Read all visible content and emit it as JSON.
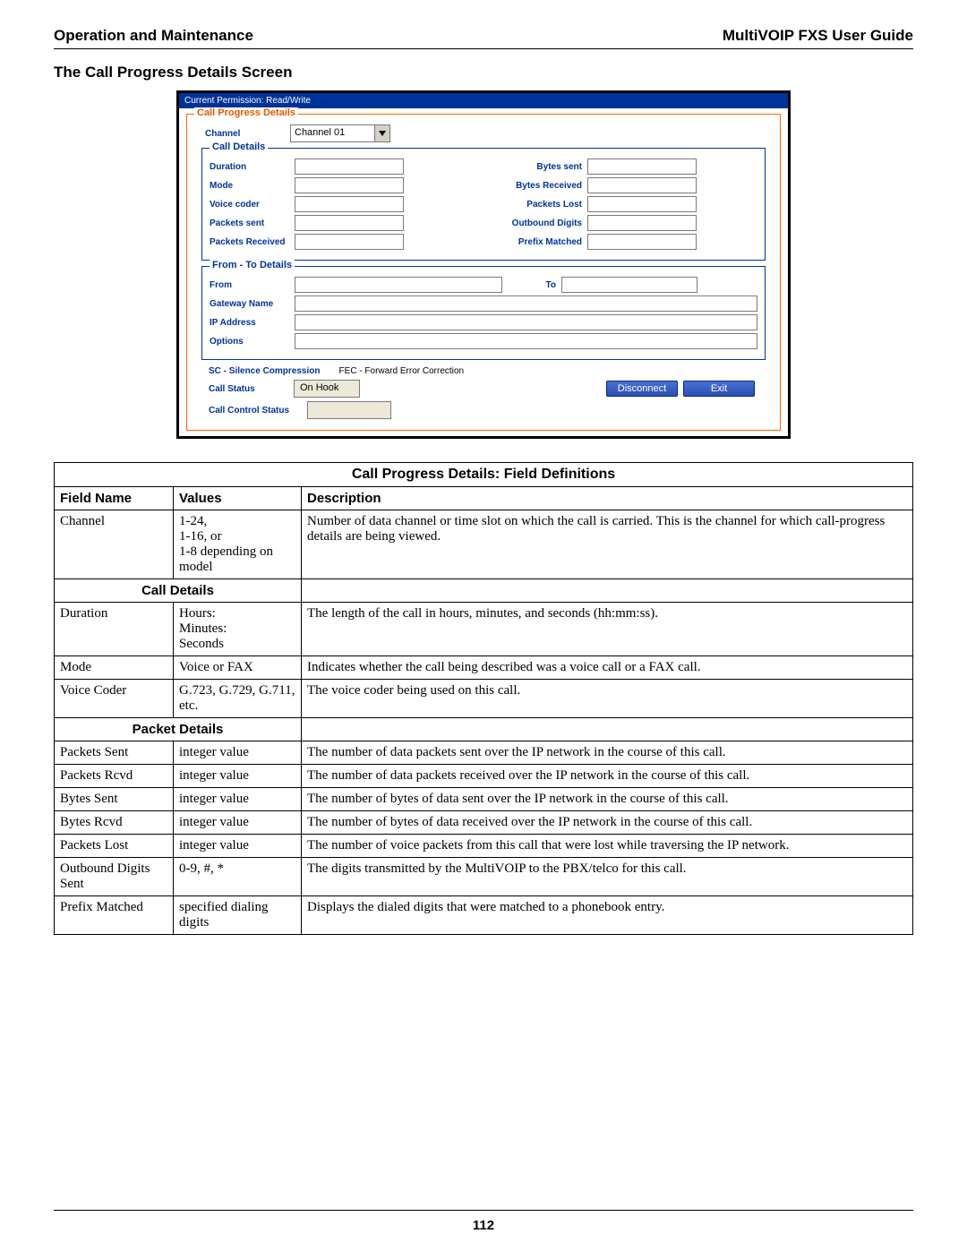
{
  "header": {
    "left": "Operation and Maintenance",
    "right": "MultiVOIP FXS User Guide"
  },
  "section_title": "The Call Progress Details Screen",
  "app": {
    "permission": "Current Permission: Read/Write",
    "main_legend": "Call Progress Details",
    "channel_label": "Channel",
    "channel_value": "Channel 01",
    "call_details_legend": "Call Details",
    "left_labels": [
      "Duration",
      "Mode",
      "Voice coder",
      "Packets sent",
      "Packets Received"
    ],
    "right_labels": [
      "Bytes sent",
      "Bytes Received",
      "Packets Lost",
      "Outbound Digits",
      "Prefix Matched"
    ],
    "fromto_legend": "From - To Details",
    "from_label": "From",
    "to_label": "To",
    "gateway_label": "Gateway Name",
    "ip_label": "IP Address",
    "options_label": "Options",
    "abbr1": "SC - Silence Compression",
    "abbr2": "FEC - Forward Error Correction",
    "call_status_label": "Call Status",
    "call_status_value": "On Hook",
    "disconnect": "Disconnect",
    "exit": "Exit",
    "call_control_label": "Call Control Status"
  },
  "table": {
    "title": "Call Progress Details: Field Definitions",
    "headers": [
      "Field Name",
      "Values",
      "Description"
    ],
    "rows": [
      {
        "type": "data",
        "field": "Channel",
        "values": "1-24,\n1-16, or\n1-8 depending on model",
        "desc": "Number of data channel or time slot on which the call is carried.  This is the channel for which call-progress details are being viewed."
      },
      {
        "type": "section",
        "label": "Call Details"
      },
      {
        "type": "data",
        "field": "Duration",
        "values": "Hours:\nMinutes:\nSeconds",
        "desc": "The length of the call in hours, minutes, and seconds (hh:mm:ss)."
      },
      {
        "type": "data",
        "field": "Mode",
        "values": "Voice or FAX",
        "desc": "Indicates whether the call being described was a voice call or a FAX call."
      },
      {
        "type": "data",
        "field": "Voice Coder",
        "values": "G.723, G.729, G.711, etc.",
        "desc": "The voice coder being used on this call."
      },
      {
        "type": "section",
        "label": "Packet Details"
      },
      {
        "type": "data",
        "field": "Packets Sent",
        "values": "integer value",
        "desc": "The number of data packets sent over the IP network in the course of this call."
      },
      {
        "type": "data",
        "field": "Packets Rcvd",
        "values": "integer value",
        "desc": "The number of data packets received over the IP network in the course of this call."
      },
      {
        "type": "data",
        "field": "Bytes Sent",
        "values": "integer value",
        "desc": "The number of bytes of data sent over the IP network in the course of this call."
      },
      {
        "type": "data",
        "field": "Bytes Rcvd",
        "values": "integer value",
        "desc": "The number of bytes of data received over the IP network in the course of this call."
      },
      {
        "type": "data",
        "field": "Packets Lost",
        "values": "integer value",
        "desc": "The number of voice packets from this call that were lost while traversing the IP network."
      },
      {
        "type": "data",
        "field": "Outbound Digits Sent",
        "values": "0-9, #, *",
        "desc": "The digits transmitted by the MultiVOIP to the PBX/telco for this call."
      },
      {
        "type": "data",
        "field": "Prefix Matched",
        "values": "specified dialing digits",
        "desc": "Displays the dialed digits that were matched to a phonebook entry."
      }
    ]
  },
  "page_number": "112"
}
